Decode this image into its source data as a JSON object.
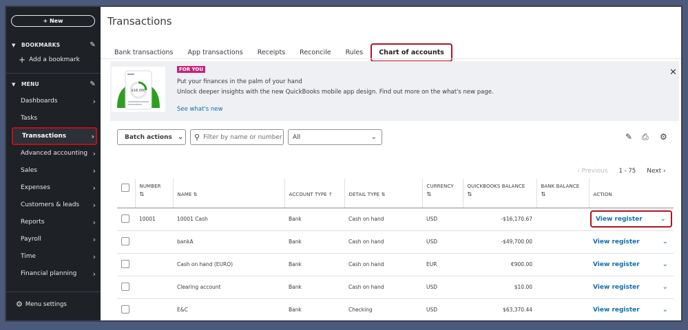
{
  "sidebar": {
    "new_label": "+ New",
    "bookmarks_label": "BOOKMARKS",
    "add_bookmark_label": "Add a bookmark",
    "menu_label": "MENU",
    "items": [
      {
        "label": "Dashboards"
      },
      {
        "label": "Tasks"
      },
      {
        "label": "Transactions"
      },
      {
        "label": "Advanced accounting"
      },
      {
        "label": "Sales"
      },
      {
        "label": "Expenses"
      },
      {
        "label": "Customers & leads"
      },
      {
        "label": "Reports"
      },
      {
        "label": "Payroll"
      },
      {
        "label": "Time"
      },
      {
        "label": "Financial planning"
      }
    ],
    "menu_settings_label": "Menu settings"
  },
  "page_title": "Transactions",
  "tabs": [
    {
      "label": "Bank transactions"
    },
    {
      "label": "App transactions"
    },
    {
      "label": "Receipts"
    },
    {
      "label": "Reconcile"
    },
    {
      "label": "Rules"
    },
    {
      "label": "Chart of accounts"
    }
  ],
  "banner": {
    "badge": "FOR YOU",
    "title": "Put your finances in the palm of your hand",
    "subtitle": "Unlock deeper insights with the new QuickBooks mobile app design. Find out more on the what's new page.",
    "link": "See what's new",
    "phone_value": "$18,000"
  },
  "toolbar": {
    "batch_label": "Batch actions",
    "search_placeholder": "Filter by name or number",
    "filter_value": "All"
  },
  "pager": {
    "prev_label": "Previous",
    "range": "1 - 75",
    "next_label": "Next"
  },
  "table": {
    "headers": {
      "number": "NUMBER",
      "name": "NAME",
      "account_type": "ACCOUNT TYPE",
      "detail_type": "DETAIL TYPE",
      "currency": "CURRENCY",
      "qb_balance": "QUICKBOOKS BALANCE",
      "bank_balance": "BANK BALANCE",
      "action": "ACTION"
    },
    "rows": [
      {
        "number": "10001",
        "name": "10001 Cash",
        "account_type": "Bank",
        "detail_type": "Cash on hand",
        "currency": "USD",
        "qb_balance": "-$16,170.67",
        "bank_balance": "",
        "action": "View register"
      },
      {
        "number": "",
        "name": "bankA",
        "account_type": "Bank",
        "detail_type": "Cash on hand",
        "currency": "USD",
        "qb_balance": "-$49,700.00",
        "bank_balance": "",
        "action": "View register"
      },
      {
        "number": "",
        "name": "Cash on hand (EURO)",
        "account_type": "Bank",
        "detail_type": "Cash on hand",
        "currency": "EUR",
        "qb_balance": "€900.00",
        "bank_balance": "",
        "action": "View register"
      },
      {
        "number": "",
        "name": "Clearing account",
        "account_type": "Bank",
        "detail_type": "Cash on hand",
        "currency": "USD",
        "qb_balance": "$10.00",
        "bank_balance": "",
        "action": "View register"
      },
      {
        "number": "",
        "name": "E&C",
        "account_type": "Bank",
        "detail_type": "Checking",
        "currency": "USD",
        "qb_balance": "$63,370.44",
        "bank_balance": "",
        "action": "View register"
      }
    ]
  },
  "colors": {
    "sidebar_bg": "#1e2126",
    "highlight_red": "#b3131b",
    "link_blue": "#0d6fad",
    "brand_green": "#2ca01c",
    "badge_pink": "#c8237a"
  }
}
